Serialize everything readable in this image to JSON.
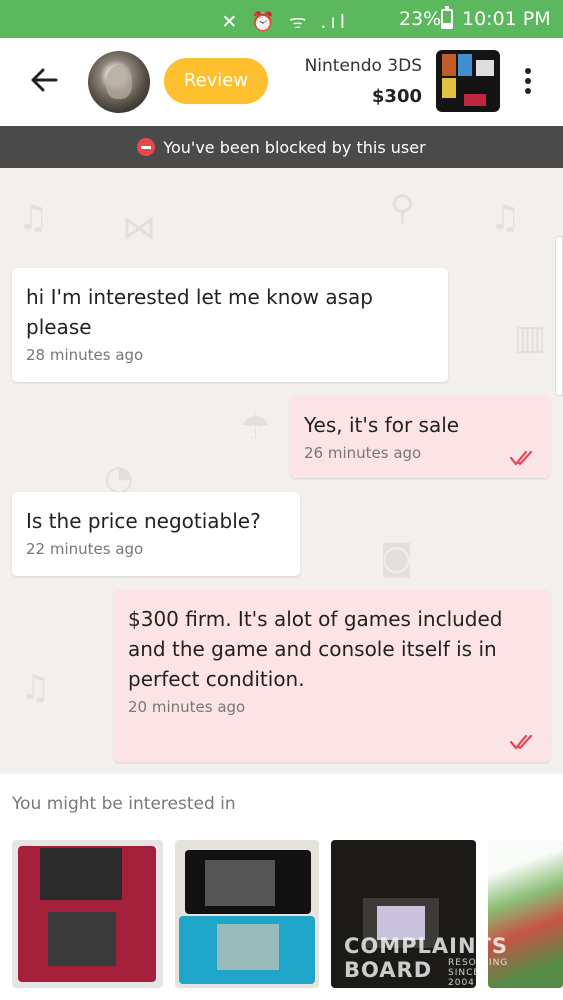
{
  "status_bar": {
    "icons": "✕ ⏰ ᯤ .ıl",
    "battery": "23%",
    "battery_level": 0.23,
    "time": "10:01 PM",
    "color": "#5cb85c"
  },
  "header": {
    "back_icon": "arrow-left-icon",
    "review_label": "Review",
    "product_title": "Nintendo 3DS",
    "product_price": "$300",
    "more_icon": "more-vertical-icon",
    "review_color": "#fdbf2e"
  },
  "banner": {
    "text": "You've been blocked by this user",
    "icon": "blocked-icon",
    "icon_color": "#e8474b"
  },
  "messages": [
    {
      "direction": "in",
      "text": "hi I'm interested let me know asap please",
      "time": "28 minutes ago"
    },
    {
      "direction": "out",
      "text": "Yes, it's for sale",
      "time": "26 minutes ago",
      "read": true
    },
    {
      "direction": "in",
      "text": "Is the price negotiable?",
      "time": "22 minutes ago"
    },
    {
      "direction": "out",
      "text": "$300 firm. It's alot of games included and the game and console itself is in perfect condition.",
      "time": "20 minutes ago",
      "read": true
    }
  ],
  "suggestions": {
    "label": "You might be interested in"
  },
  "watermark": {
    "line1": "COMPLAINTS",
    "line2": "BOARD",
    "line3": "RESOLVING",
    "line4": "SINCE 2004"
  }
}
